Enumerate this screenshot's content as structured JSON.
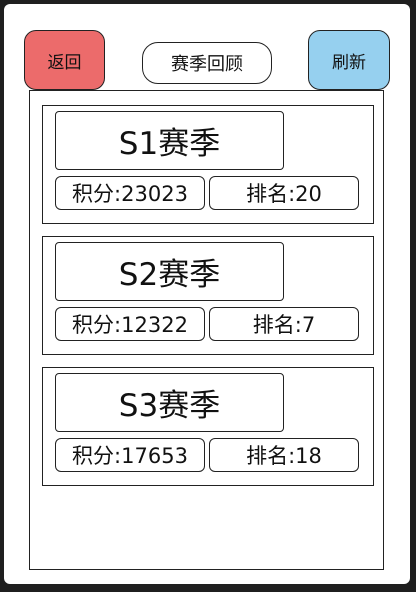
{
  "header": {
    "back_label": "返回",
    "title": "赛季回顾",
    "refresh_label": "刷新"
  },
  "colors": {
    "back_button": "#ec6b6b",
    "refresh_button": "#96d0ef"
  },
  "seasons": [
    {
      "name": "S1赛季",
      "score": "积分:23023",
      "rank": "排名:20"
    },
    {
      "name": "S2赛季",
      "score": "积分:12322",
      "rank": "排名:7"
    },
    {
      "name": "S3赛季",
      "score": "积分:17653",
      "rank": "排名:18"
    }
  ]
}
